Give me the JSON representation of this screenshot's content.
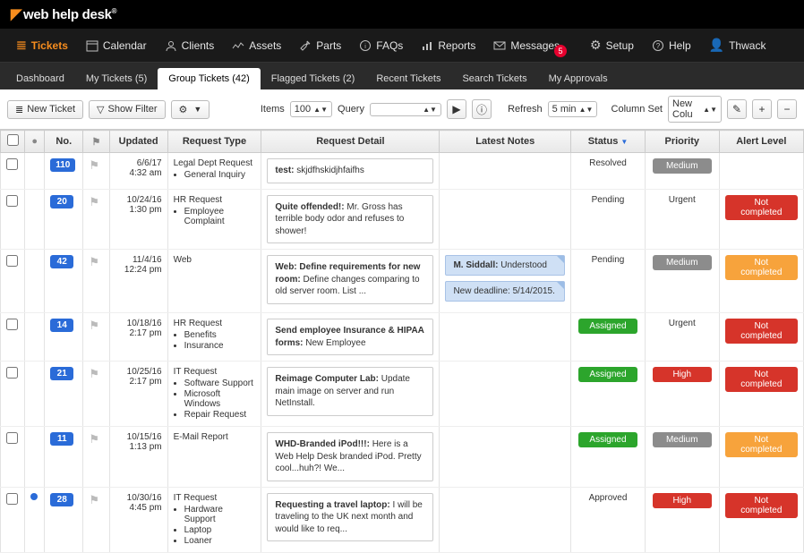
{
  "brand": "web help desk",
  "nav": [
    "Tickets",
    "Calendar",
    "Clients",
    "Assets",
    "Parts",
    "FAQs",
    "Reports",
    "Messages",
    "Setup",
    "Help",
    "Thwack"
  ],
  "msgBadge": "5",
  "subnav": [
    "Dashboard",
    "My Tickets (5)",
    "Group Tickets (42)",
    "Flagged Tickets (2)",
    "Recent Tickets",
    "Search Tickets",
    "My Approvals"
  ],
  "toolbar": {
    "newTicket": "New Ticket",
    "showFilter": "Show Filter",
    "items": "Items",
    "itemsVal": "100",
    "query": "Query",
    "refresh": "Refresh",
    "refreshVal": "5 min",
    "colset": "Column Set",
    "colsetVal": "New Colu"
  },
  "cols": [
    "",
    "",
    "No.",
    "",
    "Updated",
    "Request Type",
    "Request Detail",
    "Latest Notes",
    "Status",
    "Priority",
    "Alert Level"
  ],
  "rows": [
    {
      "no": "110",
      "date": "6/6/17",
      "time": "4:32 am",
      "type": "Legal Dept Request",
      "subs": [
        "General Inquiry"
      ],
      "dTitle": "test:",
      "dBody": " skjdfhskidjhfaifhs",
      "status": "Resolved",
      "priority": "Medium",
      "pBadge": true,
      "alert": "",
      "aClass": ""
    },
    {
      "no": "20",
      "date": "10/24/16",
      "time": "1:30 pm",
      "type": "HR Request",
      "subs": [
        "Employee Complaint"
      ],
      "dTitle": "Quite offended!:",
      "dBody": " Mr. Gross has terrible body odor and refuses to shower!",
      "status": "Pending",
      "priority": "Urgent",
      "pBadge": false,
      "alert": "Not completed",
      "aClass": "al-notcomp-r"
    },
    {
      "no": "42",
      "date": "11/4/16",
      "time": "12:24 pm",
      "type": "Web",
      "subs": [],
      "dTitle": "Web: Define requirements for new room:",
      "dBody": " Define changes comparing to old server room. List ...",
      "notes": [
        {
          "b": "M. Siddall:",
          "t": " Understood"
        },
        {
          "b": "",
          "t": "New deadline: 5/14/2015."
        }
      ],
      "status": "Pending",
      "priority": "Medium",
      "pBadge": true,
      "alert": "Not completed",
      "aClass": "al-notcomp-o"
    },
    {
      "no": "14",
      "date": "10/18/16",
      "time": "2:17 pm",
      "type": "HR Request",
      "subs": [
        "Benefits",
        "Insurance"
      ],
      "dTitle": "Send employee Insurance & HIPAA forms:",
      "dBody": " New Employee",
      "status": "Assigned",
      "sBadge": true,
      "priority": "Urgent",
      "pBadge": false,
      "alert": "Not completed",
      "aClass": "al-notcomp-r"
    },
    {
      "no": "21",
      "date": "10/25/16",
      "time": "2:17 pm",
      "type": "IT Request",
      "subs": [
        "Software Support",
        "Microsoft Windows",
        "Repair Request"
      ],
      "dTitle": "Reimage Computer Lab:",
      "dBody": " Update main image on server and run NetInstall.",
      "status": "Assigned",
      "sBadge": true,
      "priority": "High",
      "pBadge": true,
      "pClass": "pr-high",
      "alert": "Not completed",
      "aClass": "al-notcomp-r"
    },
    {
      "no": "11",
      "date": "10/15/16",
      "time": "1:13 pm",
      "type": "E-Mail Report",
      "subs": [],
      "dTitle": "WHD-Branded iPod!!!:",
      "dBody": " Here is a Web Help Desk branded iPod.  Pretty cool...huh?! We...",
      "status": "Assigned",
      "sBadge": true,
      "priority": "Medium",
      "pBadge": true,
      "alert": "Not completed",
      "aClass": "al-notcomp-o"
    },
    {
      "no": "28",
      "date": "10/30/16",
      "time": "4:45 pm",
      "type": "IT Request",
      "subs": [
        "Hardware Support",
        "Laptop",
        "Loaner"
      ],
      "dTitle": "Requesting a travel laptop:",
      "dBody": " I will be traveling to the UK next month and would like to req...",
      "dot": true,
      "status": "Approved",
      "priority": "High",
      "pBadge": true,
      "pClass": "pr-high",
      "alert": "Not completed",
      "aClass": "al-notcomp-r"
    }
  ]
}
